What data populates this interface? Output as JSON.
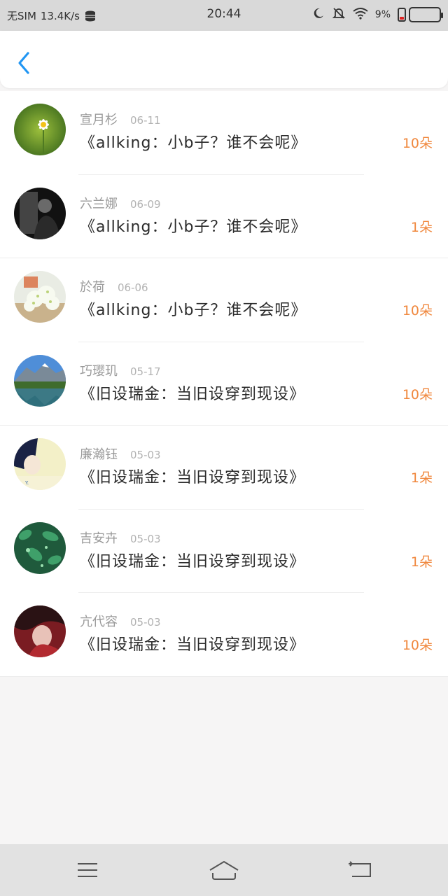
{
  "status_bar": {
    "carrier": "无SIM",
    "speed": "13.4K/s",
    "time": "20:44",
    "battery_percent": "9%",
    "icons": [
      "database-icon",
      "moon-icon",
      "bell-off-icon",
      "wifi-icon",
      "battery-icon"
    ]
  },
  "nav": {
    "back_icon": "chevron-left-icon",
    "accent": "#2196F3"
  },
  "items": [
    {
      "name": "宣月杉",
      "date": "06-11",
      "title": "《allking：小b子？谁不会呢》",
      "count": "10朵",
      "avatar": "daisy"
    },
    {
      "name": "六兰娜",
      "date": "06-09",
      "title": "《allking：小b子？谁不会呢》",
      "count": "1朵",
      "avatar": "bw-portrait"
    },
    {
      "name": "於荷",
      "date": "06-06",
      "title": "《allking：小b子？谁不会呢》",
      "count": "10朵",
      "avatar": "babys-breath"
    },
    {
      "name": "巧璎玑",
      "date": "05-17",
      "title": "《旧设瑞金：当旧设穿到现设》",
      "count": "10朵",
      "avatar": "mountain-lake"
    },
    {
      "name": "廉瀚钰",
      "date": "05-03",
      "title": "《旧设瑞金：当旧设穿到现设》",
      "count": "1朵",
      "avatar": "anime-boy"
    },
    {
      "name": "吉安卉",
      "date": "05-03",
      "title": "《旧设瑞金：当旧设穿到现设》",
      "count": "1朵",
      "avatar": "green-leaves"
    },
    {
      "name": "亢代容",
      "date": "05-03",
      "title": "《旧设瑞金：当旧设穿到现设》",
      "count": "10朵",
      "avatar": "anime-girl"
    }
  ],
  "colors": {
    "count": "#f0883e",
    "title": "#2a2a2a",
    "name": "#9a9a9a"
  },
  "bottom_nav": {
    "icons": [
      "menu-icon",
      "home-icon",
      "back-icon"
    ]
  }
}
